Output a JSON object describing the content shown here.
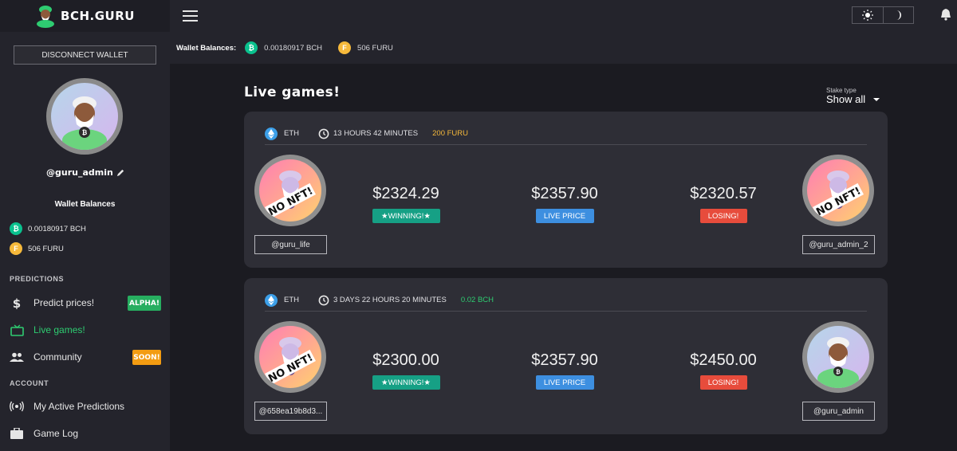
{
  "app": {
    "logo_text": "BCH.GURU"
  },
  "sidebar": {
    "disconnect_label": "DISCONNECT WALLET",
    "username": "@guru_admin",
    "wallet_title": "Wallet Balances",
    "balances": [
      {
        "icon": "bch-coin-icon",
        "value": "0.00180917 BCH"
      },
      {
        "icon": "furu-coin-icon",
        "value": "506 FURU"
      }
    ],
    "sections": [
      {
        "label": "PREDICTIONS"
      },
      {
        "label": "ACCOUNT"
      }
    ],
    "items": [
      {
        "label": "Predict prices!",
        "icon": "dollar-icon",
        "badge": "ALPHA!"
      },
      {
        "label": "Live games!",
        "icon": "tv-icon",
        "active": true
      },
      {
        "label": "Community",
        "icon": "people-icon",
        "badge": "SOON!"
      },
      {
        "label": "My Active Predictions",
        "icon": "broadcast-icon"
      },
      {
        "label": "Game Log",
        "icon": "briefcase-icon"
      }
    ]
  },
  "topbar": {
    "balances_label": "Wallet Balances:",
    "bch": "0.00180917 BCH",
    "furu": "506 FURU"
  },
  "main": {
    "title": "Live games!",
    "stake_caption": "Stake type",
    "stake_value": "Show all",
    "games": [
      {
        "asset": "ETH",
        "time": "13 HOURS 42 MINUTES",
        "stake": "200 FURU",
        "left_player": "@guru_life",
        "right_player": "@guru_admin_2",
        "left_price": "$2324.29",
        "live_price": "$2357.90",
        "right_price": "$2320.57",
        "left_tag": "★WINNING!★",
        "live_tag": "LIVE PRICE",
        "right_tag": "LOSING!",
        "left_avatar_text": "NO NFT!",
        "right_avatar_text": "NO NFT!"
      },
      {
        "asset": "ETH",
        "time": "3 DAYS 22 HOURS 20 MINUTES",
        "stake": "0.02 BCH",
        "left_player": "@658ea19b8d3...",
        "right_player": "@guru_admin",
        "left_price": "$2300.00",
        "live_price": "$2357.90",
        "right_price": "$2450.00",
        "left_tag": "★WINNING!★",
        "live_tag": "LIVE PRICE",
        "right_tag": "LOSING!",
        "left_avatar_text": "NO NFT!"
      }
    ]
  },
  "colors": {
    "bg": "#1b1b21",
    "panel": "#24242c",
    "card": "#2e2e36",
    "green": "#2ecc71",
    "winning": "#16a085",
    "live": "#3d8fe0",
    "losing": "#e74c3c",
    "furu": "#f6b93b",
    "bch": "#0ac18e"
  }
}
